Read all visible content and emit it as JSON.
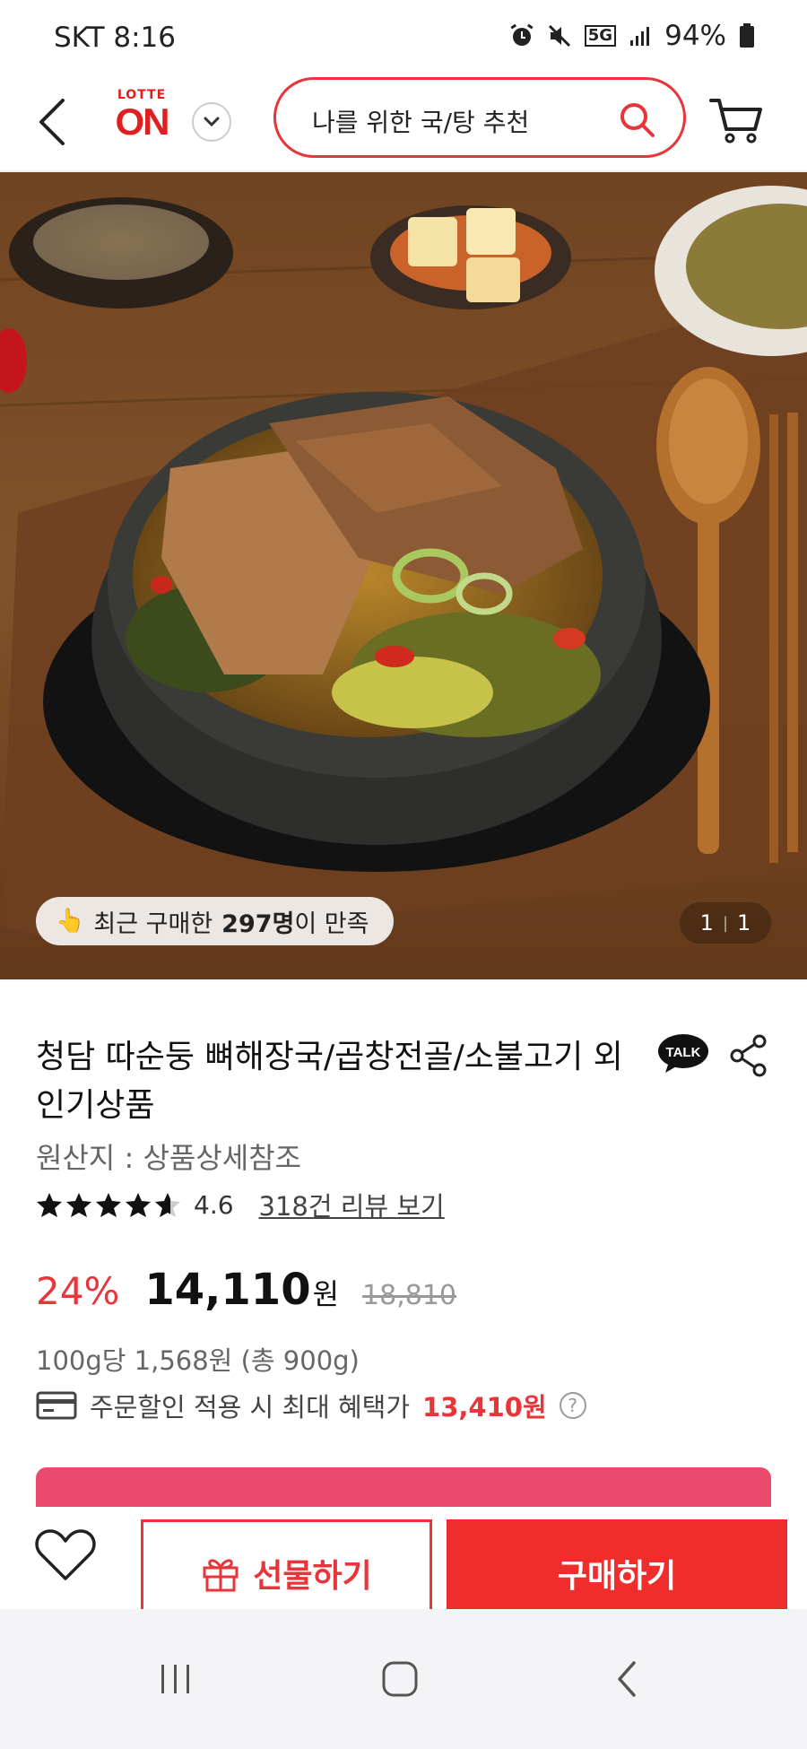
{
  "status_bar": {
    "carrier_time": "SKT 8:16",
    "network": "5G",
    "battery": "94%"
  },
  "header": {
    "logo_top": "LOTTE",
    "logo_main": "ON",
    "search_text": "나를 위한 국/탕 추천"
  },
  "hero": {
    "review_prefix": "최근 구매한 ",
    "review_count": "297명",
    "review_suffix": "이 만족",
    "page_current": "1",
    "page_total": "1"
  },
  "product": {
    "title": "청담 따순둥 뼈해장국/곱창전골/소불고기 외 인기상품",
    "talk_label": "TALK",
    "origin": "원산지 : 상품상세참조",
    "rating": "4.6",
    "rating_value": 4.6,
    "review_link": "318건 리뷰 보기",
    "discount": "24%",
    "price": "14,110",
    "price_unit": "원",
    "original_price": "18,810",
    "unit_price": "100g당 1,568원 (총 900g)",
    "benefit_text": "주문할인 적용 시 최대 혜택가",
    "benefit_price": "13,410원",
    "help_glyph": "?"
  },
  "actions": {
    "gift_label": "선물하기",
    "buy_label": "구매하기"
  },
  "colors": {
    "accent": "#e8353a",
    "buy": "#f02d2d",
    "pink_banner": "#ea4a6b"
  }
}
